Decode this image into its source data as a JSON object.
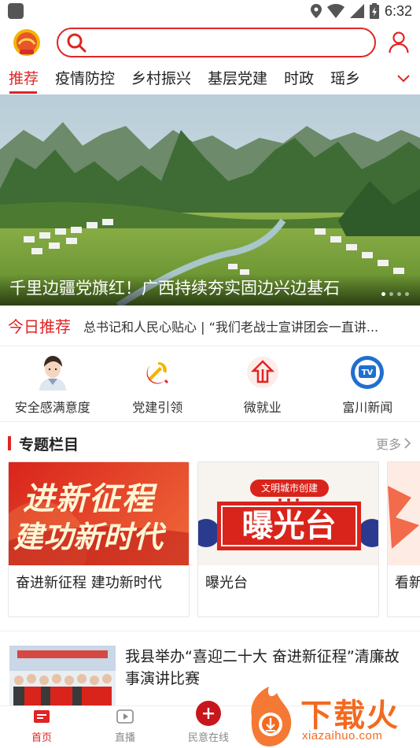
{
  "status_bar": {
    "time": "6:32",
    "icons": [
      "location-icon",
      "wifi-icon",
      "signal-icon",
      "battery-icon"
    ]
  },
  "header": {
    "logo_icon": "county-emblem-icon",
    "search_placeholder": "",
    "user_icon": "user-icon"
  },
  "tabs": {
    "items": [
      "推荐",
      "疫情防控",
      "乡村振兴",
      "基层党建",
      "时政",
      "瑶乡"
    ],
    "active_index": 0,
    "expand_icon": "chevron-down-icon"
  },
  "banner": {
    "caption": "千里边疆党旗红！广西持续夯实固边兴边基石",
    "slide_count": 4,
    "active_slide": 0
  },
  "today": {
    "label": "今日推荐",
    "text": "总书记和人民心贴心 | “我们老战士宣讲团会一直讲..."
  },
  "quick_links": [
    {
      "label": "安全感满意度",
      "icon": "police-avatar-icon"
    },
    {
      "label": "党建引领",
      "icon": "party-emblem-icon"
    },
    {
      "label": "微就业",
      "icon": "employment-icon"
    },
    {
      "label": "富川新闻",
      "icon": "tv-news-icon"
    }
  ],
  "topics": {
    "title": "专题栏目",
    "more": "更多",
    "cards": [
      {
        "title": "奋进新征程 建功新时代",
        "image_text_1": "进新征程",
        "image_text_2": "建功新时代"
      },
      {
        "title": "曝光台",
        "image_tag": "文明城市创建",
        "image_big": "曝光台"
      },
      {
        "title": "看新"
      }
    ]
  },
  "news": [
    {
      "title": "我县举办“喜迎二十大 奋进新征程”清廉故事演讲比赛"
    }
  ],
  "bottom_nav": [
    {
      "label": "首页",
      "icon": "home-icon",
      "active": true
    },
    {
      "label": "直播",
      "icon": "play-icon",
      "active": false
    },
    {
      "label": "民意在线",
      "icon": "plus-circle-icon",
      "active": false
    }
  ],
  "watermark": {
    "brand": "下载火",
    "url": "xiazaihuo.com"
  },
  "colors": {
    "accent": "#e02424"
  }
}
